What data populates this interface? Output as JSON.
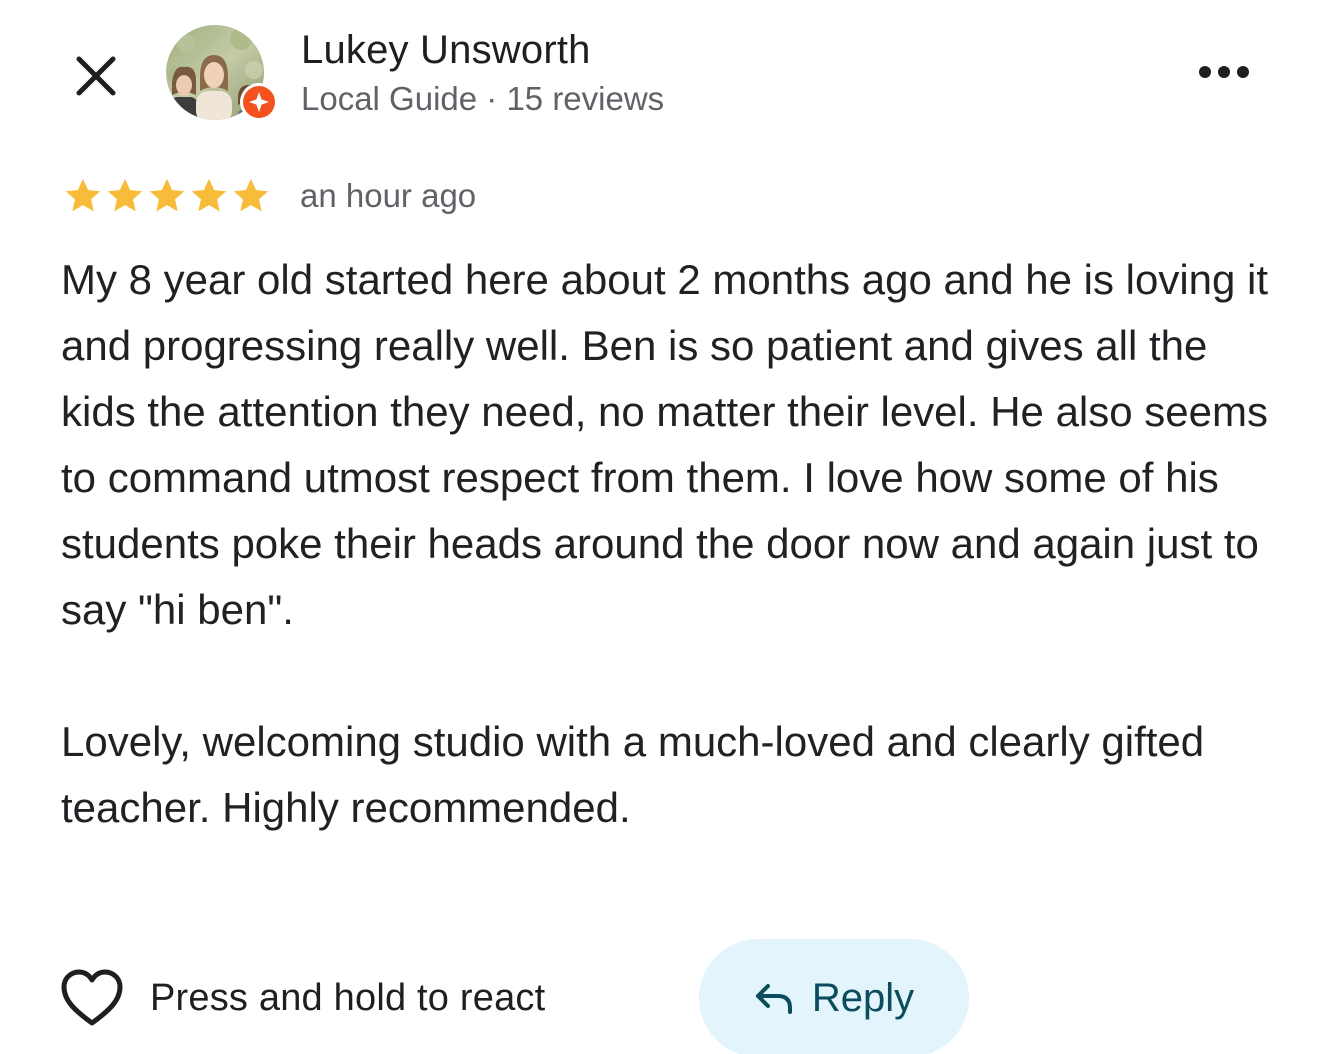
{
  "header": {
    "close_icon": "close-icon",
    "more_icon": "more-horiz-icon",
    "user": {
      "name": "Lukey Unsworth",
      "meta": "Local Guide · 15 reviews",
      "avatar_icon": "profile-photo",
      "badge_icon": "local-guide-badge-icon"
    }
  },
  "review": {
    "rating": 5,
    "rating_max": 5,
    "time": "an hour ago",
    "paragraphs": [
      "My 8 year old started here about 2 months ago and he is loving it and progressing really well. Ben is so patient and gives all the kids the attention they need, no matter their level. He also seems to command utmost respect from them. I love how some of his students poke their heads around the door now and again just to say \"hi ben\".",
      "Lovely, welcoming studio with a much-loved and clearly gifted teacher. Highly recommended."
    ]
  },
  "actions": {
    "react_label": "Press and hold to react",
    "react_icon": "heart-outline-icon",
    "reply_label": "Reply",
    "reply_icon": "reply-arrow-icon"
  },
  "colors": {
    "star": "#f6bc3a",
    "badge": "#f4511e",
    "reply_bg": "#e3f4fc",
    "reply_text": "#0b4d5c",
    "secondary_text": "#5f6368"
  }
}
